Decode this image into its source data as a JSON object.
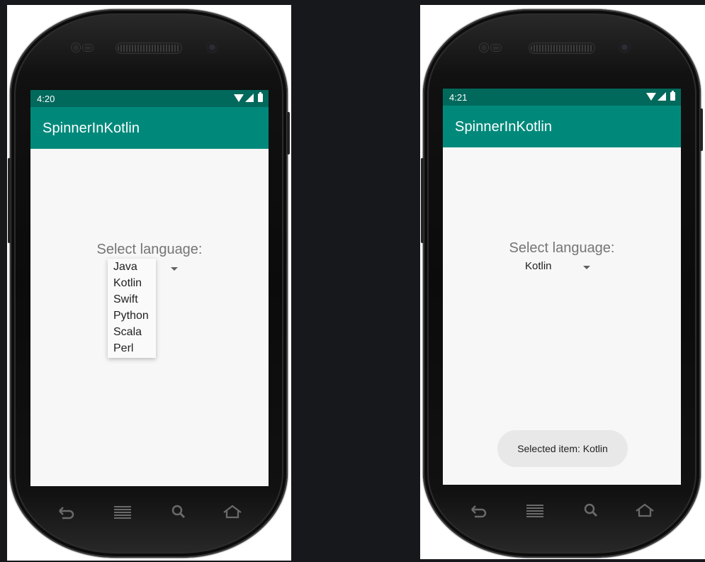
{
  "left_phone": {
    "time": "4:20",
    "app_title": "SpinnerInKotlin",
    "label": "Select language:",
    "dropdown_items": [
      "Java",
      "Kotlin",
      "Swift",
      "Python",
      "Scala",
      "Perl"
    ]
  },
  "right_phone": {
    "time": "4:21",
    "app_title": "SpinnerInKotlin",
    "label": "Select language:",
    "selected_value": "Kotlin",
    "toast": "Selected item: Kotlin"
  },
  "colors": {
    "status_bar": "#00695c",
    "app_bar": "#00897b",
    "screen_bg": "#f7f7f7",
    "page_bg": "#17181c"
  },
  "icons": [
    "wifi-icon",
    "signal-icon",
    "battery-icon",
    "caret-down-icon",
    "back-icon",
    "menu-icon",
    "search-icon",
    "home-icon"
  ]
}
